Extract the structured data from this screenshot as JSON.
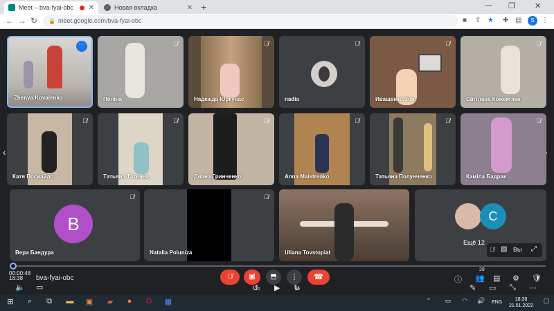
{
  "browser": {
    "tabs": [
      {
        "title": "Meet – bva-fyai-obc"
      },
      {
        "title": "Новая вкладка"
      }
    ],
    "url": "meet.google.com/bva-fyai-obc",
    "profile_initial": "S"
  },
  "participants": [
    {
      "name": "Zhenya Kovalenko"
    },
    {
      "name": "Поліна"
    },
    {
      "name": "Надежда Юркунас"
    },
    {
      "name": "nadia"
    },
    {
      "name": "Иващенко Зоя"
    },
    {
      "name": "Світлана Кожем'яка"
    },
    {
      "name": "Катя Посиайло"
    },
    {
      "name": "Татьяна Татьяна"
    },
    {
      "name": "Диана Гринченко"
    },
    {
      "name": "Anna Maistrenko"
    },
    {
      "name": "Татьяна Полунченко"
    },
    {
      "name": "Каміла Бадрак"
    },
    {
      "name": "Вера Бандура",
      "avatar_letter": "B",
      "avatar_color": "#b04fc9"
    },
    {
      "name": "Natalia Poluniza"
    },
    {
      "name": "Uliana Tovstopiat"
    }
  ],
  "overflow": {
    "label": "Ещё 12",
    "avatar_letter": "C",
    "avatar_color": "#1a8fb8",
    "self_label": "Вы"
  },
  "player": {
    "time": "00:00:48",
    "clock_overlay": "18:38",
    "meeting_code": "bva-fyai-obc",
    "rewind_label": "10",
    "forward_label": "30",
    "people_count": "28"
  },
  "taskbar": {
    "time": "18:38",
    "date": "21.01.2022",
    "lang": "ENG"
  },
  "colors": {
    "meet_bg": "#202124",
    "tile_bg": "#3c4043",
    "accent": "#8ab4f8",
    "end_call": "#ea4335"
  }
}
